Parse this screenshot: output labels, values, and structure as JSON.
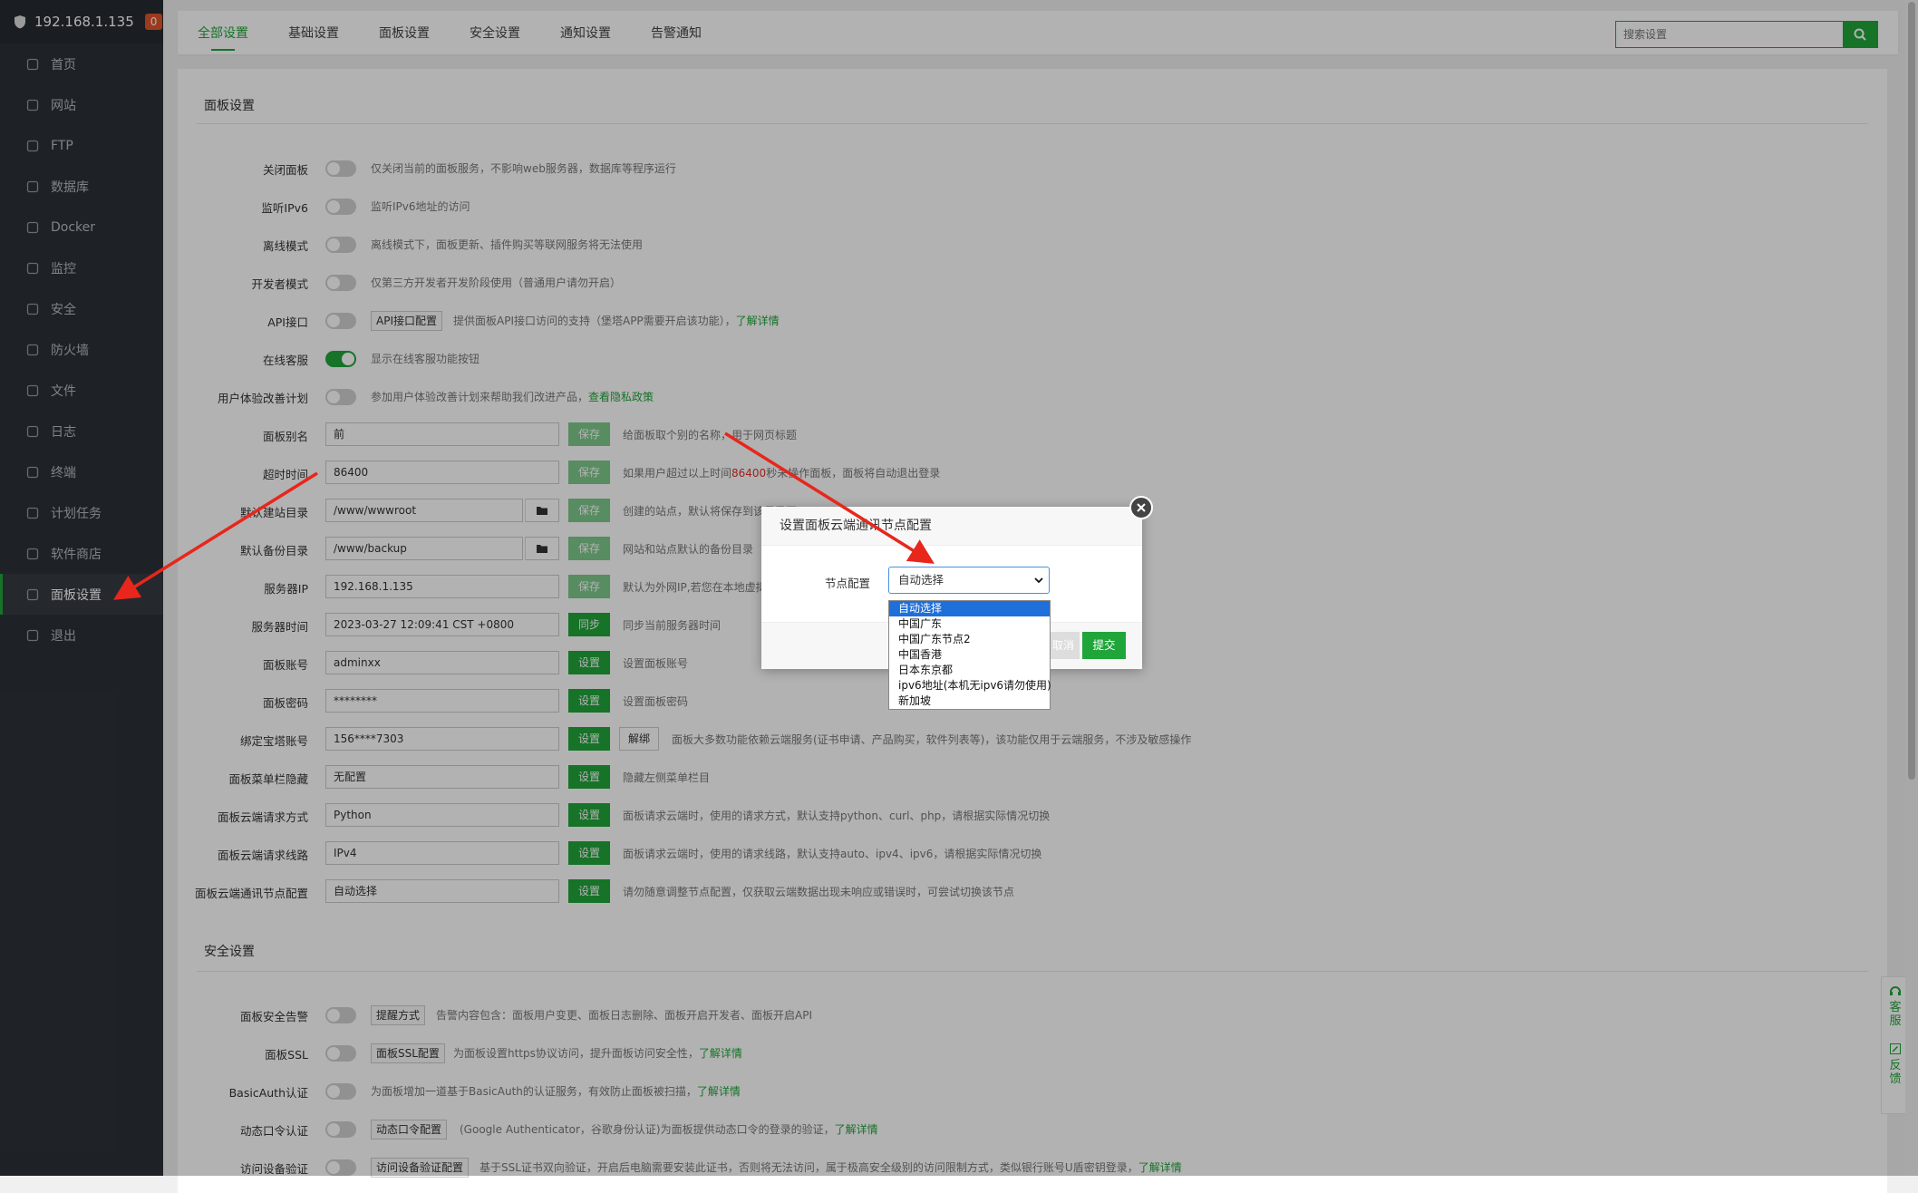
{
  "server": {
    "ip": "192.168.1.135",
    "badge": "0"
  },
  "sidebar": {
    "items": [
      {
        "label": "首页",
        "icon": "home-icon"
      },
      {
        "label": "网站",
        "icon": "globe-icon"
      },
      {
        "label": "FTP",
        "icon": "ftp-icon"
      },
      {
        "label": "数据库",
        "icon": "database-icon"
      },
      {
        "label": "Docker",
        "icon": "docker-icon"
      },
      {
        "label": "监控",
        "icon": "monitor-icon"
      },
      {
        "label": "安全",
        "icon": "shield-icon"
      },
      {
        "label": "防火墙",
        "icon": "firewall-icon"
      },
      {
        "label": "文件",
        "icon": "folder-icon"
      },
      {
        "label": "日志",
        "icon": "log-icon"
      },
      {
        "label": "终端",
        "icon": "terminal-icon"
      },
      {
        "label": "计划任务",
        "icon": "calendar-icon"
      },
      {
        "label": "软件商店",
        "icon": "store-icon"
      },
      {
        "label": "面板设置",
        "icon": "gear-icon"
      },
      {
        "label": "退出",
        "icon": "logout-icon"
      }
    ],
    "active_index": 13
  },
  "tabs": [
    "全部设置",
    "基础设置",
    "面板设置",
    "安全设置",
    "通知设置",
    "告警通知"
  ],
  "search": {
    "placeholder": "搜索设置"
  },
  "panel_section": {
    "title": "面板设置",
    "toggles": [
      {
        "label": "关闭面板",
        "desc": "仅关闭当前的面板服务，不影响web服务器，数据库等程序运行"
      },
      {
        "label": "监听IPv6",
        "desc": "监听IPv6地址的访问"
      },
      {
        "label": "离线模式",
        "desc": "离线模式下，面板更新、插件购买等联网服务将无法使用"
      },
      {
        "label": "开发者模式",
        "desc": "仅第三方开发者开发阶段使用（普通用户请勿开启）"
      },
      {
        "label": "API接口",
        "button": "API接口配置",
        "desc": "提供面板API接口访问的支持（堡塔APP需要开启该功能），",
        "link": "了解详情"
      },
      {
        "label": "在线客服",
        "desc": "显示在线客服功能按钮",
        "on": true
      },
      {
        "label": "用户体验改善计划",
        "desc": "参加用户体验改善计划来帮助我们改进产品，",
        "link": "查看隐私政策"
      }
    ],
    "fields": {
      "alias": {
        "label": "面板别名",
        "value": "前",
        "btn": "保存",
        "desc": "给面板取个别的名称，用于网页标题"
      },
      "timeout": {
        "label": "超时时间",
        "value": "86400",
        "btn": "保存",
        "desc_pre": "如果用户超过以上时间",
        "desc_red": "86400",
        "desc_post": "秒未操作面板，面板将自动退出登录"
      },
      "site_dir": {
        "label": "默认建站目录",
        "value": "/www/wwwroot",
        "btn": "保存",
        "desc": "创建的站点，默认将保存到该目录下"
      },
      "backup_dir": {
        "label": "默认备份目录",
        "value": "/www/backup",
        "btn": "保存",
        "desc": "网站和站点默认的备份目录"
      },
      "server_ip": {
        "label": "服务器IP",
        "value": "192.168.1.135",
        "btn": "保存",
        "desc": "默认为外网IP,若您在本地虚拟机测试"
      },
      "server_time": {
        "label": "服务器时间",
        "value": "2023-03-27 12:09:41 CST +0800",
        "btn": "同步",
        "desc": "同步当前服务器时间"
      },
      "account": {
        "label": "面板账号",
        "value": "adminxx",
        "btn": "设置",
        "desc": "设置面板账号"
      },
      "password": {
        "label": "面板密码",
        "value": "********",
        "btn": "设置",
        "desc": "设置面板密码"
      },
      "bt_account": {
        "label": "绑定宝塔账号",
        "value": "156****7303",
        "btn": "设置",
        "btn2": "解绑",
        "desc": "面板大多数功能依赖云端服务(证书申请、产品购买，软件列表等)，该功能仅用于云端服务，不涉及敏感操作"
      },
      "menu_hide": {
        "label": "面板菜单栏隐藏",
        "value": "无配置",
        "btn": "设置",
        "desc": "隐藏左侧菜单栏目"
      },
      "req_method": {
        "label": "面板云端请求方式",
        "value": "Python",
        "btn": "设置",
        "desc": "面板请求云端时，使用的请求方式，默认支持python、curl、php，请根据实际情况切换"
      },
      "req_line": {
        "label": "面板云端请求线路",
        "value": "IPv4",
        "btn": "设置",
        "desc": "面板请求云端时，使用的请求线路，默认支持auto、ipv4、ipv6，请根据实际情况切换"
      },
      "node": {
        "label": "面板云端通讯节点配置",
        "value": "自动选择",
        "btn": "设置",
        "desc": "请勿随意调整节点配置，仅获取云端数据出现未响应或错误时，可尝试切换该节点"
      }
    }
  },
  "security_section": {
    "title": "安全设置",
    "rows": [
      {
        "label": "面板安全告警",
        "button": "提醒方式",
        "desc": "告警内容包含：面板用户变更、面板日志删除、面板开启开发者、面板开启API"
      },
      {
        "label": "面板SSL",
        "button": "面板SSL配置",
        "desc": "为面板设置https协议访问，提升面板访问安全性，",
        "link": "了解详情"
      },
      {
        "label": "BasicAuth认证",
        "desc": "为面板增加一道基于BasicAuth的认证服务，有效防止面板被扫描，",
        "link": "了解详情"
      },
      {
        "label": "动态口令认证",
        "button": "动态口令配置",
        "desc": "(Google Authenticator，谷歌身份认证)为面板提供动态口令的登录的验证，",
        "link": "了解详情"
      },
      {
        "label": "访问设备验证",
        "button": "访问设备验证配置",
        "desc": "基于SSL证书双向验证，开启后电脑需要安装此证书，否则将无法访问，属于极高安全级别的访问限制方式，类似银行账号U盾密钥登录，",
        "link": "了解详情"
      }
    ]
  },
  "dialog": {
    "title": "设置面板云端通讯节点配置",
    "label": "节点配置",
    "selected": "自动选择",
    "options": [
      "自动选择",
      "中国广东",
      "中国广东节点2",
      "中国香港",
      "日本东京都",
      "ipv6地址(本机无ipv6请勿使用)",
      "新加坡"
    ],
    "cancel": "取消",
    "submit": "提交"
  },
  "float": {
    "service": "客服",
    "feedback": "反馈"
  },
  "colors": {
    "accent": "#20a53a",
    "sidebar_bg": "#2c3138",
    "arrow": "#e8261c"
  }
}
